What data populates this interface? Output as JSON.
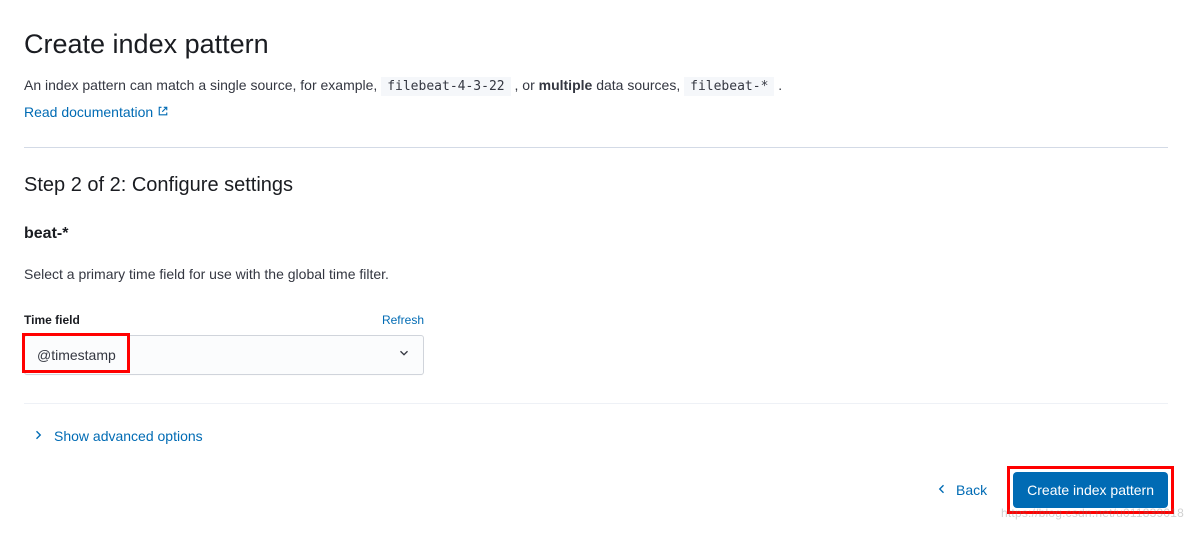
{
  "header": {
    "title": "Create index pattern",
    "subtitle_pre": "An index pattern can match a single source, for example, ",
    "code_single": "filebeat-4-3-22",
    "subtitle_mid": " , or ",
    "subtitle_bold": "multiple",
    "subtitle_post": " data sources, ",
    "code_multi": "filebeat-*",
    "subtitle_end": " .",
    "doc_link": "Read documentation"
  },
  "step": {
    "title": "Step 2 of 2: Configure settings",
    "pattern": "beat-*",
    "help": "Select a primary time field for use with the global time filter."
  },
  "timefield": {
    "label": "Time field",
    "refresh": "Refresh",
    "value": "@timestamp"
  },
  "advanced": {
    "label": "Show advanced options"
  },
  "footer": {
    "back": "Back",
    "create": "Create index pattern"
  },
  "watermark": "https://blog.csdn.net/u011839018"
}
